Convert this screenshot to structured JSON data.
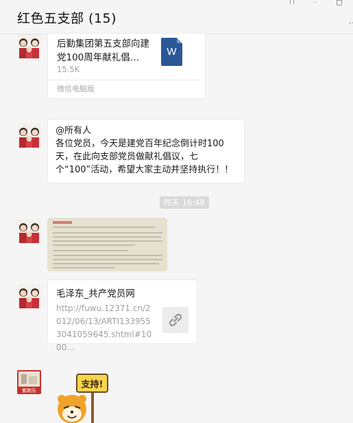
{
  "chat": {
    "title": "红色五支部 (15)"
  },
  "window_controls": [
    "pin",
    "minimize",
    "maximize"
  ],
  "messages": {
    "file": {
      "name": "后勤集团第五支部向建党100周年献礼倡…",
      "size": "15.5K",
      "icon_letter": "W",
      "source": "微信电脑版"
    },
    "text": {
      "content": "@所有人\n各位党员，今天是建党百年纪念倒计时100天，在此向支部党员做献礼倡议，七个“100”活动，希望大家主动并坚持执行！！"
    },
    "timestamp": "昨天 16:48",
    "link": {
      "title": "毛泽东_共产党员网",
      "url": "http://fuwu.12371.cn/2012/06/13/ARTI1339553041059645.shtml#1000..."
    },
    "sticker": {
      "caption": "支持!"
    },
    "sender_badge": "紫荆乐"
  },
  "colors": {
    "background": "#f5f5f5",
    "bubble": "#ffffff",
    "word_blue": "#2b5797",
    "timestamp_bg": "#dadada"
  }
}
